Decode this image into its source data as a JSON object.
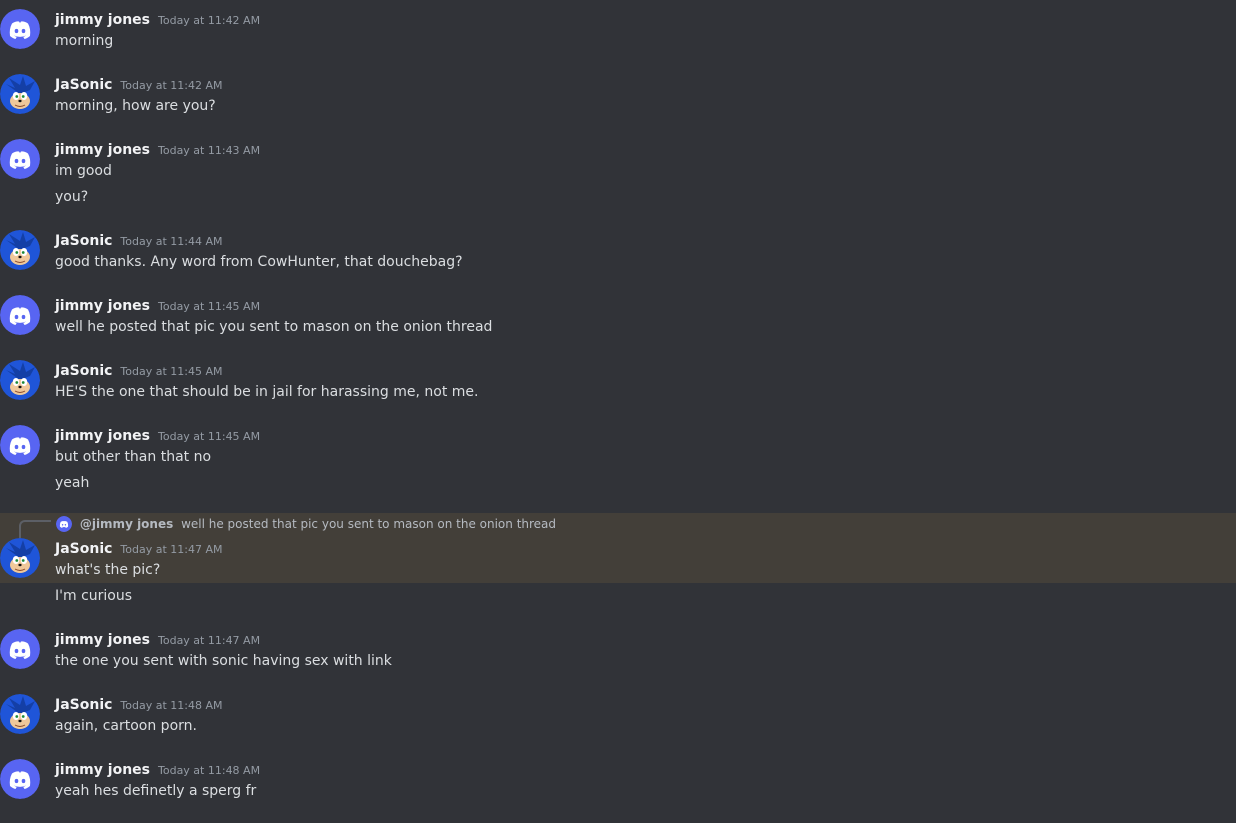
{
  "colors": {
    "background": "#313338",
    "discord_avatar": "#5865f2",
    "sonic_blue": "#1f55d8",
    "reply_highlight": "#433f39"
  },
  "users": {
    "jimmy": "jimmy jones",
    "jasonic": "JaSonic"
  },
  "messages": [
    {
      "author": "jimmy jones",
      "avatar": "discord-logo-icon",
      "timestamp": "Today at 11:42 AM",
      "lines": [
        "morning"
      ]
    },
    {
      "author": "JaSonic",
      "avatar": "sonic-avatar-icon",
      "timestamp": "Today at 11:42 AM",
      "lines": [
        "morning, how are you?"
      ]
    },
    {
      "author": "jimmy jones",
      "avatar": "discord-logo-icon",
      "timestamp": "Today at 11:43 AM",
      "lines": [
        "im good",
        "you?"
      ]
    },
    {
      "author": "JaSonic",
      "avatar": "sonic-avatar-icon",
      "timestamp": "Today at 11:44 AM",
      "lines": [
        "good thanks. Any word from CowHunter, that douchebag?"
      ]
    },
    {
      "author": "jimmy jones",
      "avatar": "discord-logo-icon",
      "timestamp": "Today at 11:45 AM",
      "lines": [
        "well he posted that pic you sent to mason on the onion thread"
      ]
    },
    {
      "author": "JaSonic",
      "avatar": "sonic-avatar-icon",
      "timestamp": "Today at 11:45 AM",
      "lines": [
        "HE'S the one that should be in jail for harassing me, not me."
      ]
    },
    {
      "author": "jimmy jones",
      "avatar": "discord-logo-icon",
      "timestamp": "Today at 11:45 AM",
      "lines": [
        "but other than that no",
        "yeah"
      ]
    },
    {
      "author": "JaSonic",
      "avatar": "sonic-avatar-icon",
      "timestamp": "Today at 11:47 AM",
      "lines": [
        "what's the pic?",
        "I'm curious"
      ]
    },
    {
      "author": "jimmy jones",
      "avatar": "discord-logo-icon",
      "timestamp": "Today at 11:47 AM",
      "lines": [
        "the one you sent with sonic having sex with link"
      ]
    },
    {
      "author": "JaSonic",
      "avatar": "sonic-avatar-icon",
      "timestamp": "Today at 11:48 AM",
      "lines": [
        "again, cartoon porn."
      ]
    },
    {
      "author": "jimmy jones",
      "avatar": "discord-logo-icon",
      "timestamp": "Today at 11:48 AM",
      "lines": [
        "yeah hes definetly a sperg fr"
      ]
    }
  ],
  "reply": {
    "mention": "@jimmy jones",
    "text": "well he posted that pic you sent to mason on the onion thread",
    "avatar": "discord-logo-icon"
  }
}
